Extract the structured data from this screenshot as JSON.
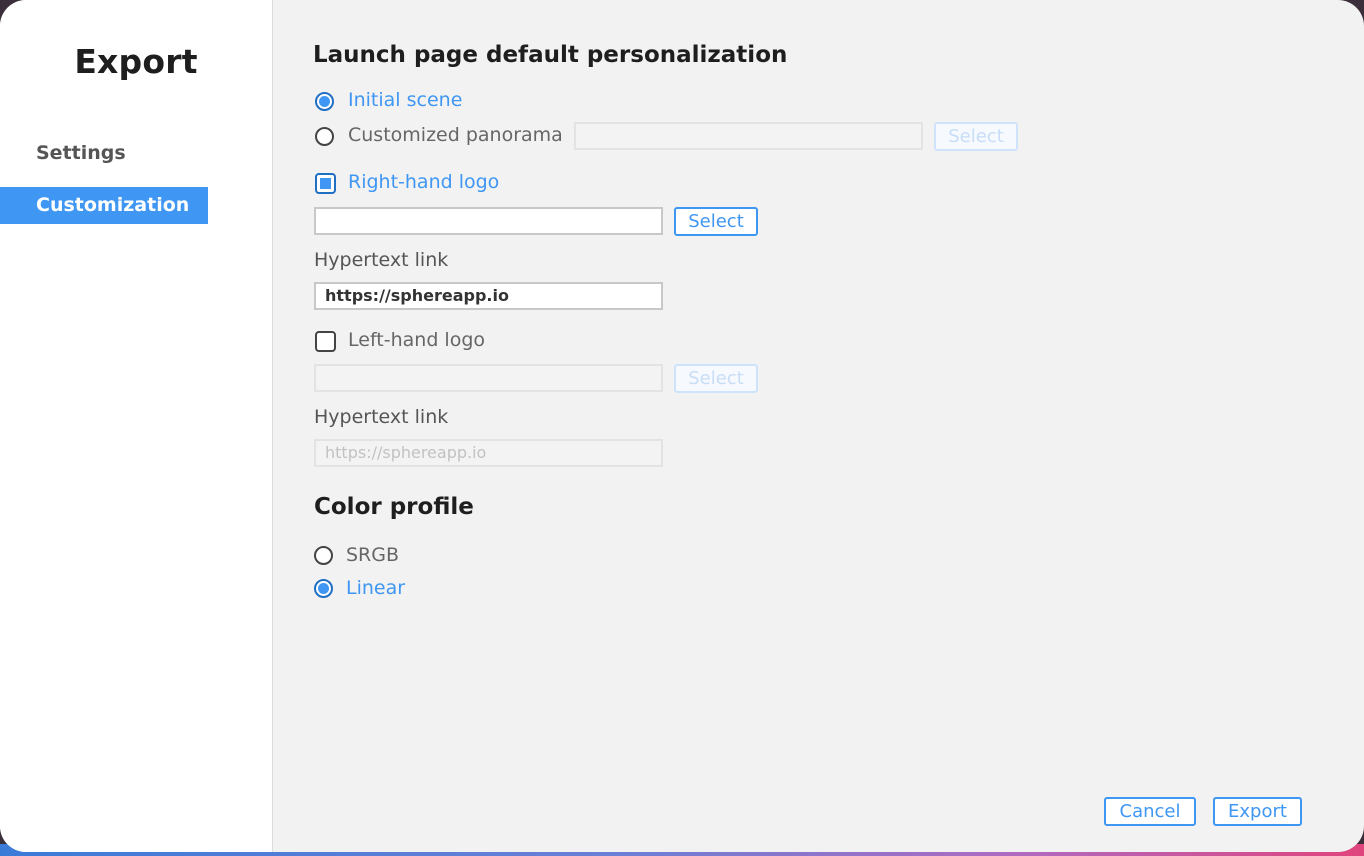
{
  "sidebar": {
    "title": "Export",
    "items": [
      {
        "label": "Settings"
      },
      {
        "label": "Customization"
      }
    ]
  },
  "launch": {
    "heading": "Launch page default personalization",
    "option_initial": "Initial scene",
    "option_custom": "Customized panorama",
    "custom_select": "Select",
    "selected_option": "Initial scene"
  },
  "right_logo": {
    "label": "Right-hand logo",
    "checked": true,
    "file_value": "",
    "select": "Select",
    "link_label": "Hypertext link",
    "link_value": "https://sphereapp.io"
  },
  "left_logo": {
    "label": "Left-hand logo",
    "checked": false,
    "file_value": "",
    "select": "Select",
    "link_label": "Hypertext link",
    "link_value": "https://sphereapp.io"
  },
  "color_profile": {
    "heading": "Color profile",
    "option_srgb": "SRGB",
    "option_linear": "Linear",
    "selected_option": "Linear"
  },
  "footer": {
    "cancel": "Cancel",
    "export": "Export"
  },
  "colors": {
    "accent": "#3f97f3",
    "sidebar_active": "#3f97f3",
    "panel_bg": "#f2f2f2"
  }
}
